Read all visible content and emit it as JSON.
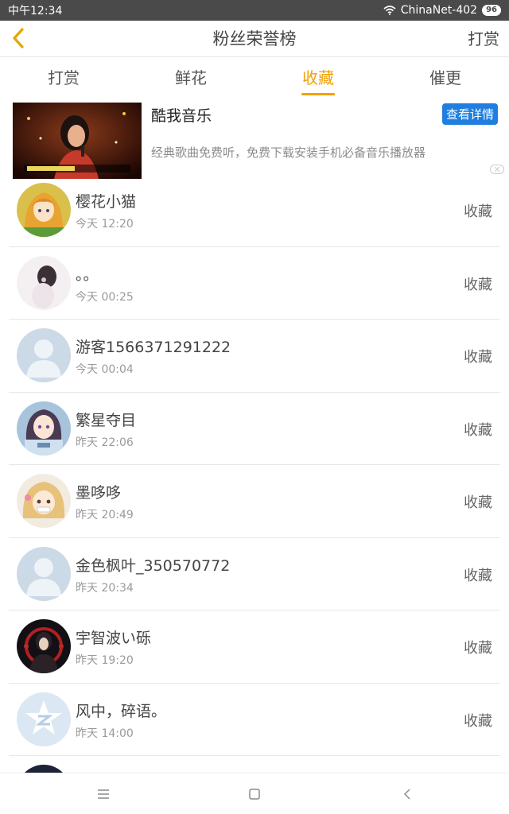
{
  "status_bar": {
    "time": "中午12:34",
    "network": "ChinaNet-402",
    "battery": "96"
  },
  "header": {
    "title": "粉丝荣誉榜",
    "right_label": "打赏"
  },
  "tabs": [
    {
      "label": "打赏",
      "active": false
    },
    {
      "label": "鲜花",
      "active": false
    },
    {
      "label": "收藏",
      "active": true
    },
    {
      "label": "催更",
      "active": false
    }
  ],
  "ad": {
    "title": "酷我音乐",
    "button_label": "查看详情",
    "description": "经典歌曲免费听，免费下载安装手机必备音乐播放器"
  },
  "fans": [
    {
      "name": "樱花小猫",
      "time": "今天 12:20",
      "action": "收藏",
      "avatar": "anime-girl-yellow"
    },
    {
      "name": "。。",
      "time": "今天 00:25",
      "action": "收藏",
      "avatar": "girl-braid"
    },
    {
      "name": "游客1566371291222",
      "time": "今天 00:04",
      "action": "收藏",
      "avatar": "default-person"
    },
    {
      "name": "繁星夺目",
      "time": "昨天 22:06",
      "action": "收藏",
      "avatar": "anime-girl-blue"
    },
    {
      "name": "墨哆哆",
      "time": "昨天 20:49",
      "action": "收藏",
      "avatar": "anime-girl-blonde"
    },
    {
      "name": "金色枫叶_350570772",
      "time": "昨天 20:34",
      "action": "收藏",
      "avatar": "default-person"
    },
    {
      "name": "宇智波い砾",
      "time": "昨天 19:20",
      "action": "收藏",
      "avatar": "anime-dark"
    },
    {
      "name": "风中，碎语。",
      "time": "昨天 14:00",
      "action": "收藏",
      "avatar": "qzone-star"
    }
  ],
  "colors": {
    "accent": "#f2a100",
    "ad_button": "#1f7ee0",
    "divider": "#e6e6e6"
  },
  "nav_icons": [
    "menu-icon",
    "home-square-icon",
    "back-chevron-icon"
  ]
}
